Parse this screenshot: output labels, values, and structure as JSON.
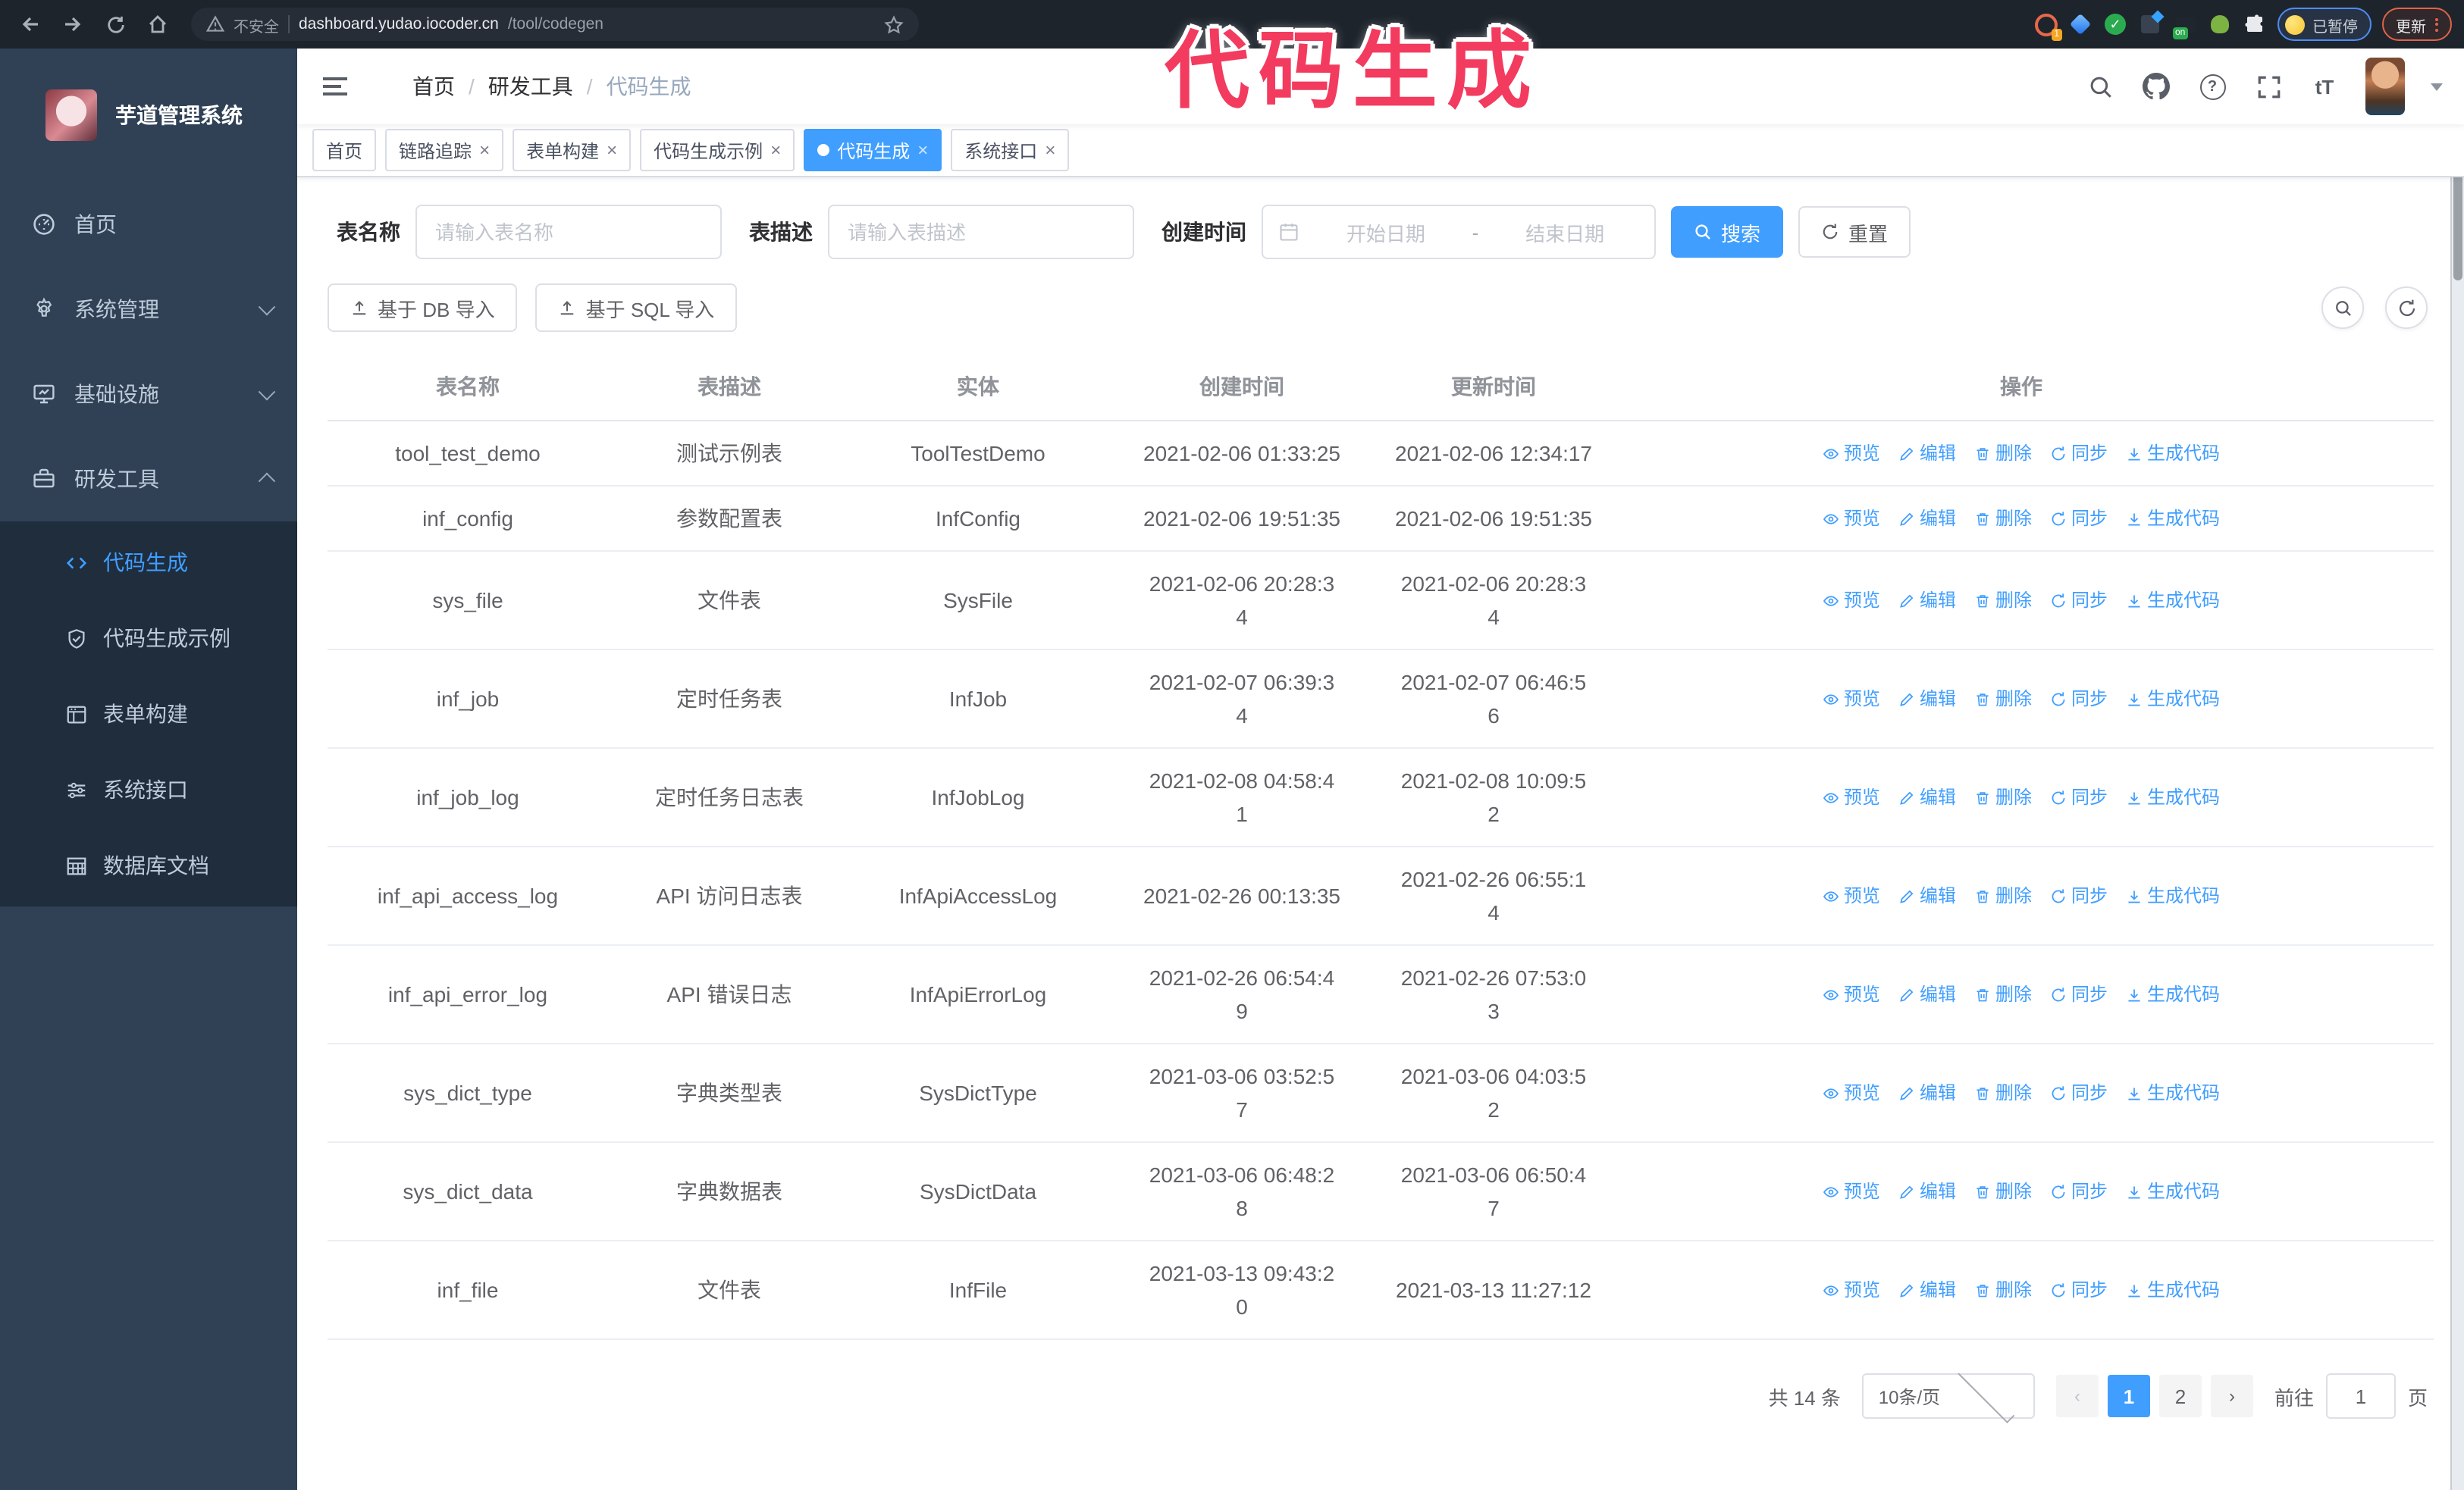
{
  "colors": {
    "accent": "#409EFF",
    "annotation": "#f23b5e",
    "sidebar_bg": "#304156",
    "submenu_bg": "#1f2d3d",
    "chrome_bg": "#1e242c"
  },
  "browser": {
    "security_label": "不安全",
    "url_host": "dashboard.yudao.iocoder.cn",
    "url_path": "/tool/codegen",
    "extension_badge": "1",
    "extension_on_badge": "on",
    "paused_badge": "已暂停",
    "update_button": "更新"
  },
  "annotation": {
    "text": "代码生成"
  },
  "sidebar": {
    "title": "芋道管理系统",
    "items": [
      {
        "label": "首页"
      },
      {
        "label": "系统管理"
      },
      {
        "label": "基础设施"
      },
      {
        "label": "研发工具"
      }
    ],
    "subitems": [
      {
        "label": "代码生成"
      },
      {
        "label": "代码生成示例"
      },
      {
        "label": "表单构建"
      },
      {
        "label": "系统接口"
      },
      {
        "label": "数据库文档"
      }
    ]
  },
  "navbar": {
    "breadcrumb": [
      "首页",
      "研发工具",
      "代码生成"
    ]
  },
  "tabs": [
    {
      "label": "首页"
    },
    {
      "label": "链路追踪"
    },
    {
      "label": "表单构建"
    },
    {
      "label": "代码生成示例"
    },
    {
      "label": "代码生成"
    },
    {
      "label": "系统接口"
    }
  ],
  "filters": {
    "table_name_label": "表名称",
    "table_name_placeholder": "请输入表名称",
    "table_desc_label": "表描述",
    "table_desc_placeholder": "请输入表描述",
    "create_time_label": "创建时间",
    "start_placeholder": "开始日期",
    "range_separator": "-",
    "end_placeholder": "结束日期",
    "search_label": "搜索",
    "reset_label": "重置"
  },
  "toolbar": {
    "import_db_label": "基于 DB 导入",
    "import_sql_label": "基于 SQL 导入"
  },
  "table": {
    "columns": [
      "表名称",
      "表描述",
      "实体",
      "创建时间",
      "更新时间",
      "操作"
    ],
    "actions": [
      "预览",
      "编辑",
      "删除",
      "同步",
      "生成代码"
    ],
    "rows": [
      {
        "name": "tool_test_demo",
        "desc": "测试示例表",
        "entity": "ToolTestDemo",
        "created": "2021-02-06 01:33:25",
        "updated": "2021-02-06 12:34:17"
      },
      {
        "name": "inf_config",
        "desc": "参数配置表",
        "entity": "InfConfig",
        "created": "2021-02-06 19:51:35",
        "updated": "2021-02-06 19:51:35"
      },
      {
        "name": "sys_file",
        "desc": "文件表",
        "entity": "SysFile",
        "created": "2021-02-06 20:28:3\n4",
        "updated": "2021-02-06 20:28:3\n4"
      },
      {
        "name": "inf_job",
        "desc": "定时任务表",
        "entity": "InfJob",
        "created": "2021-02-07 06:39:3\n4",
        "updated": "2021-02-07 06:46:5\n6"
      },
      {
        "name": "inf_job_log",
        "desc": "定时任务日志表",
        "entity": "InfJobLog",
        "created": "2021-02-08 04:58:4\n1",
        "updated": "2021-02-08 10:09:5\n2"
      },
      {
        "name": "inf_api_access_log",
        "desc": "API 访问日志表",
        "entity": "InfApiAccessLog",
        "created": "2021-02-26 00:13:35",
        "updated": "2021-02-26 06:55:1\n4"
      },
      {
        "name": "inf_api_error_log",
        "desc": "API 错误日志",
        "entity": "InfApiErrorLog",
        "created": "2021-02-26 06:54:4\n9",
        "updated": "2021-02-26 07:53:0\n3"
      },
      {
        "name": "sys_dict_type",
        "desc": "字典类型表",
        "entity": "SysDictType",
        "created": "2021-03-06 03:52:5\n7",
        "updated": "2021-03-06 04:03:5\n2"
      },
      {
        "name": "sys_dict_data",
        "desc": "字典数据表",
        "entity": "SysDictData",
        "created": "2021-03-06 06:48:2\n8",
        "updated": "2021-03-06 06:50:4\n7"
      },
      {
        "name": "inf_file",
        "desc": "文件表",
        "entity": "InfFile",
        "created": "2021-03-13 09:43:2\n0",
        "updated": "2021-03-13 11:27:12"
      }
    ]
  },
  "pagination": {
    "total_label": "共 14 条",
    "page_size": "10条/页",
    "pages": [
      "1",
      "2"
    ],
    "active_page": "1",
    "goto_label": "前往",
    "goto_value": "1",
    "page_unit": "页"
  }
}
